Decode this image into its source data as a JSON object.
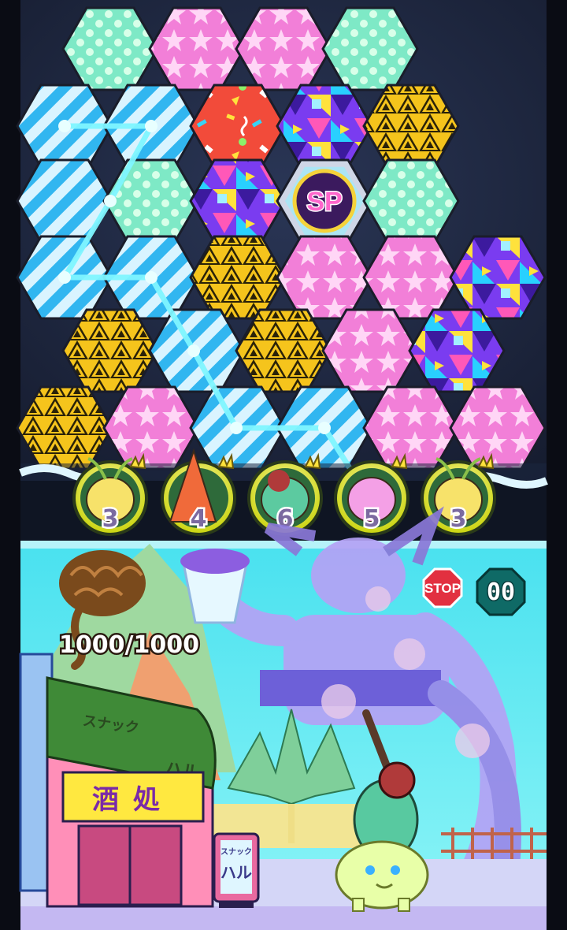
{
  "hp": {
    "label": "1000/1000",
    "current": 1000,
    "max": 1000
  },
  "timer": {
    "value": "00"
  },
  "stop_button": {
    "label": "STOP"
  },
  "special_tile": {
    "label": "SP"
  },
  "units": [
    {
      "kind": "yellow-bean-unit",
      "count": "3"
    },
    {
      "kind": "traffic-cone-unit",
      "count": "4"
    },
    {
      "kind": "helmet-batter-unit",
      "count": "6"
    },
    {
      "kind": "pink-blob-unit",
      "count": "5"
    },
    {
      "kind": "yellow-bean-unit",
      "count": "3"
    }
  ],
  "board": {
    "rows": [
      [
        "dots",
        "stars",
        "stars",
        "dots"
      ],
      [
        "stripes",
        "stripes",
        "confetti",
        "cubes",
        "triangles"
      ],
      [
        "stripes",
        "dots",
        "cubes",
        "sp",
        "dots"
      ],
      [
        "stripes",
        "stripes",
        "triangles",
        "stars",
        "stars",
        "cubes"
      ],
      [
        "triangles",
        "stripes",
        "triangles",
        "stars",
        "cubes"
      ],
      [
        "triangles",
        "stars",
        "stripes",
        "stripes",
        "stars",
        "stars"
      ]
    ]
  },
  "scene": {
    "shop_sign": {
      "top": "スナック",
      "bottom": "ハル",
      "banner": "酒処"
    },
    "small_sign": {
      "top": "スナック",
      "bottom": "ハル"
    }
  },
  "colors": {
    "board_bg": "#2c3145",
    "chain_line": "#7ff6ff",
    "scene_sky": "#43e3f2",
    "giant_body": "#b4a2f5",
    "shop_roof": "#3f8a37"
  }
}
